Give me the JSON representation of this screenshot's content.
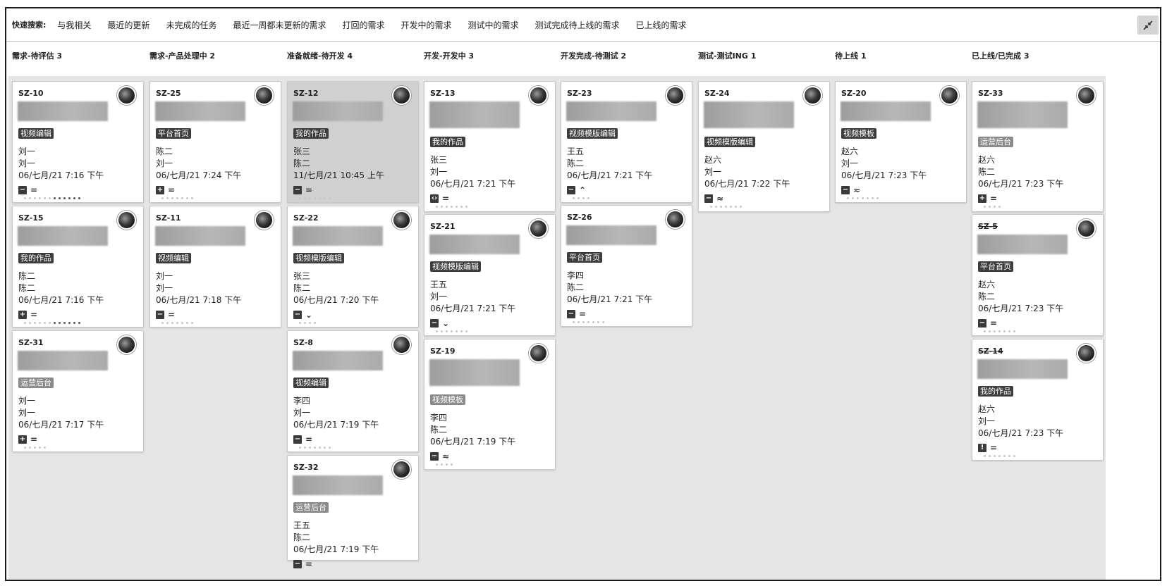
{
  "quick_search": {
    "label": "快速搜索:",
    "filters": [
      "与我相关",
      "最近的更新",
      "未完成的任务",
      "最近一周都未更新的需求",
      "打回的需求",
      "开发中的需求",
      "测试中的需求",
      "测试完成待上线的需求",
      "已上线的需求"
    ]
  },
  "columns": [
    {
      "title": "需求-待评估 3",
      "cards": [
        {
          "key": "SZ-10",
          "tag": "视频编辑",
          "tag_style": "dark",
          "line1": "刘一",
          "line2": "刘一",
          "date": "06/七月/21 7:16 下午",
          "type_icon": "minus",
          "priority": "medium",
          "dots": 12,
          "dots_done": 6
        },
        {
          "key": "SZ-15",
          "tag": "我的作品",
          "tag_style": "dark",
          "line1": "陈二",
          "line2": "陈二",
          "date": "06/七月/21 7:16 下午",
          "type_icon": "plus",
          "priority": "medium",
          "dots": 12,
          "dots_done": 6
        },
        {
          "key": "SZ-31",
          "tag": "运营后台",
          "tag_style": "light",
          "line1": "刘一",
          "line2": "刘一",
          "date": "06/七月/21 7:17 下午",
          "type_icon": "plus",
          "priority": "medium",
          "dots": 5,
          "dots_done": 0
        }
      ]
    },
    {
      "title": "需求-产品处理中 2",
      "cards": [
        {
          "key": "SZ-25",
          "tag": "平台首页",
          "tag_style": "dark",
          "line1": "陈二",
          "line2": "刘一",
          "date": "06/七月/21 7:24 下午",
          "type_icon": "plus",
          "priority": "medium",
          "dots": 7,
          "dots_done": 0
        },
        {
          "key": "SZ-11",
          "tag": "视频编辑",
          "tag_style": "dark",
          "line1": "刘一",
          "line2": "刘一",
          "date": "06/七月/21 7:18 下午",
          "type_icon": "minus",
          "priority": "medium",
          "dots": 7,
          "dots_done": 0
        }
      ]
    },
    {
      "title": "准备就绪-待开发 4",
      "cards": [
        {
          "key": "SZ-12",
          "tag": "我的作品",
          "tag_style": "dark",
          "line1": "张三",
          "line2": "陈二",
          "date": "11/七月/21 10:45 上午",
          "type_icon": "minus",
          "priority": "medium",
          "dots": 7,
          "dots_done": 0,
          "selected": true
        },
        {
          "key": "SZ-22",
          "tag": "视频模版编辑",
          "tag_style": "dark",
          "line1": "张三",
          "line2": "陈二",
          "date": "06/七月/21 7:20 下午",
          "type_icon": "minus",
          "priority": "low",
          "dots": 4,
          "dots_done": 0
        },
        {
          "key": "SZ-8",
          "tag": "视频编辑",
          "tag_style": "dark",
          "line1": "李四",
          "line2": "刘一",
          "date": "06/七月/21 7:19 下午",
          "type_icon": "minus",
          "priority": "medium",
          "dots": 7,
          "dots_done": 0
        },
        {
          "key": "SZ-32",
          "tag": "运营后台",
          "tag_style": "light",
          "line1": "王五",
          "line2": "陈二",
          "date": "06/七月/21 7:19 下午",
          "type_icon": "minus",
          "priority": "medium",
          "dots": 0,
          "dots_done": 0
        }
      ]
    },
    {
      "title": "开发-开发中 3",
      "cards": [
        {
          "key": "SZ-13",
          "tag": "我的作品",
          "tag_style": "dark",
          "line1": "张三",
          "line2": "刘一",
          "date": "06/七月/21 7:21 下午",
          "type_icon": "code",
          "priority": "medium",
          "dots": 7,
          "dots_done": 0
        },
        {
          "key": "SZ-21",
          "tag": "视频模版编辑",
          "tag_style": "dark",
          "line1": "王五",
          "line2": "刘一",
          "date": "06/七月/21 7:21 下午",
          "type_icon": "minus",
          "priority": "low",
          "dots": 7,
          "dots_done": 0
        },
        {
          "key": "SZ-19",
          "tag": "视频模板",
          "tag_style": "light",
          "line1": "李四",
          "line2": "陈二",
          "date": "06/七月/21 7:19 下午",
          "type_icon": "minus",
          "priority": "highest",
          "dots": 4,
          "dots_done": 0
        }
      ]
    },
    {
      "title": "开发完成-待测试 2",
      "cards": [
        {
          "key": "SZ-23",
          "tag": "视频模版编辑",
          "tag_style": "dark",
          "line1": "王五",
          "line2": "陈二",
          "date": "06/七月/21 7:21 下午",
          "type_icon": "minus",
          "priority": "high",
          "dots": 4,
          "dots_done": 0
        },
        {
          "key": "SZ-26",
          "tag": "平台首页",
          "tag_style": "dark",
          "line1": "李四",
          "line2": "陈二",
          "date": "06/七月/21 7:21 下午",
          "type_icon": "minus",
          "priority": "medium",
          "dots": 7,
          "dots_done": 0
        }
      ]
    },
    {
      "title": "测试-测试ING 1",
      "cards": [
        {
          "key": "SZ-24",
          "tag": "视频模版编辑",
          "tag_style": "dark",
          "line1": "赵六",
          "line2": "刘一",
          "date": "06/七月/21 7:22 下午",
          "type_icon": "minus",
          "priority": "highest",
          "dots": 7,
          "dots_done": 0
        }
      ]
    },
    {
      "title": "待上线 1",
      "cards": [
        {
          "key": "SZ-20",
          "tag": "视频模板",
          "tag_style": "dark",
          "line1": "赵六",
          "line2": "刘一",
          "date": "06/七月/21 7:23 下午",
          "type_icon": "minus",
          "priority": "highest",
          "dots": 7,
          "dots_done": 0
        }
      ]
    },
    {
      "title": "已上线/已完成 3",
      "cards": [
        {
          "key": "SZ-33",
          "tag": "运营后台",
          "tag_style": "light",
          "line1": "赵六",
          "line2": "陈二",
          "date": "06/七月/21 7:23 下午",
          "type_icon": "plus",
          "priority": "medium",
          "dots": 4,
          "dots_done": 0
        },
        {
          "key": "SZ-5",
          "tag": "平台首页",
          "tag_style": "dark",
          "line1": "赵六",
          "line2": "陈二",
          "date": "06/七月/21 7:23 下午",
          "type_icon": "minus",
          "priority": "medium",
          "dots": 7,
          "dots_done": 0,
          "done": true
        },
        {
          "key": "SZ-14",
          "tag": "我的作品",
          "tag_style": "dark",
          "line1": "赵六",
          "line2": "刘一",
          "date": "06/七月/21 7:23 下午",
          "type_icon": "bug",
          "priority": "medium",
          "dots": 7,
          "dots_done": 0,
          "done": true
        }
      ]
    }
  ],
  "icons": {
    "collapse": "collapse-icon",
    "avatar": "user-avatar",
    "type_minus": "minus-icon",
    "type_plus": "plus-icon",
    "type_code": "code-icon",
    "type_bug": "exclamation-icon"
  },
  "colors": {
    "lane_bg": "#e5e5e5",
    "card_bg": "#ffffff",
    "selected_card_bg": "#d0d0d0",
    "tag_dark": "#3d3d3d",
    "tag_light": "#8a8a8a"
  }
}
